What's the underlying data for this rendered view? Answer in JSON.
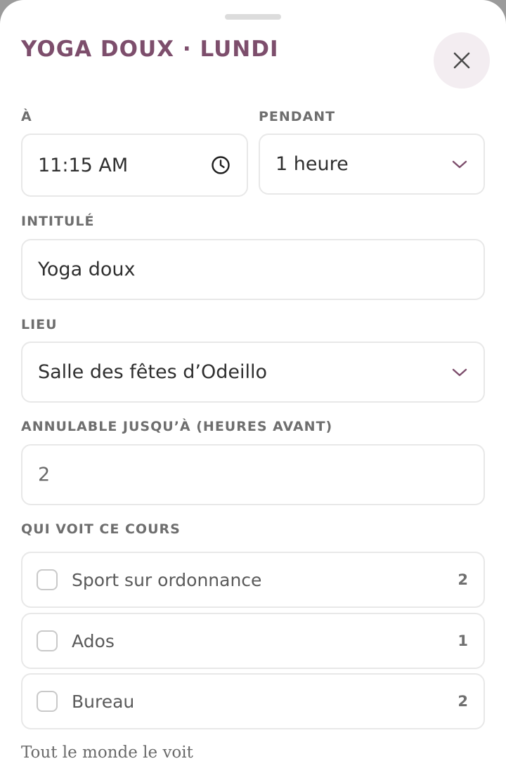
{
  "sheet": {
    "title": "YOGA DOUX · LUNDI",
    "close_icon": "close-icon"
  },
  "time": {
    "label": "À",
    "value": "11:15 AM",
    "icon": "clock-icon"
  },
  "duration": {
    "label": "PENDANT",
    "value": "1 heure",
    "icon": "chevron-down-icon"
  },
  "title_field": {
    "label": "INTITULÉ",
    "value": "Yoga doux"
  },
  "location": {
    "label": "LIEU",
    "value": "Salle des fêtes d’Odeillo",
    "icon": "chevron-down-icon"
  },
  "cancel_window": {
    "label": "ANNULABLE JUSQU’À (HEURES AVANT)",
    "value": "2"
  },
  "visibility": {
    "label": "QUI VOIT CE COURS",
    "groups": [
      {
        "name": "Sport sur ordonnance",
        "count": "2",
        "checked": false
      },
      {
        "name": "Ados",
        "count": "1",
        "checked": false
      },
      {
        "name": "Bureau",
        "count": "2",
        "checked": false
      }
    ],
    "footer": "Tout le monde le voit"
  },
  "colors": {
    "accent": "#7d4e6c",
    "close_bg": "#f3edf1",
    "border": "#e8e8e8"
  }
}
